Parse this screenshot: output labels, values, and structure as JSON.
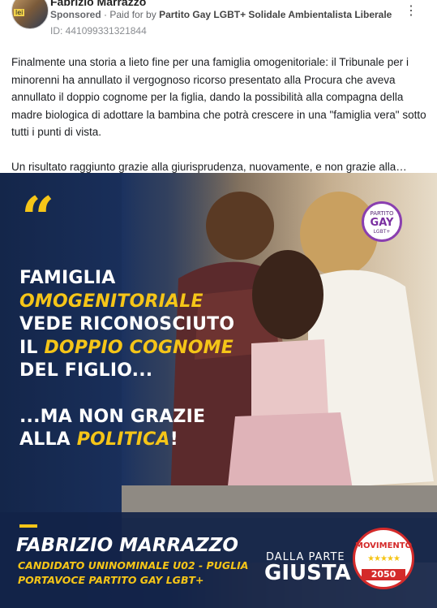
{
  "post": {
    "author": "Fabrizio Marrazzo",
    "avatar_tag": "lei",
    "sponsored": "Sponsored",
    "paid_for_prefix": "· Paid for by",
    "advertiser": "Partito Gay LGBT+ Solidale Ambientalista Liberale",
    "library_id": "ID: 441099331321844",
    "more_icon": "⋮",
    "paragraphs": [
      "Finalmente una storia a lieto fine per una famiglia omogenitoriale: il Tribunale per i minorenni ha annullato il vergognoso ricorso presentato alla Procura che aveva annullato il doppio cognome per la figlia, dando la possibilità alla compagna della madre biologica di adottare la bambina che potrà crescere in una \"famiglia vera\" sotto tutti i punti di vista.",
      "Un risultato raggiunto grazie alla giurisprudenza, nuovamente, e non grazie alla…"
    ]
  },
  "creative": {
    "quote_mark": "“",
    "headline": {
      "l1": "FAMIGLIA",
      "l2": "OMOGENITORIALE",
      "l3": "VEDE RICONOSCIUTO",
      "l4a": "IL ",
      "l4b": "DOPPIO COGNOME",
      "l5": "DEL FIGLIO...",
      "l6": "...MA NON GRAZIE",
      "l7a": "ALLA ",
      "l7b": "POLITICA",
      "l7c": "!"
    },
    "candidate": {
      "name": "FABRIZIO MARRAZZO",
      "line1": "CANDIDATO UNINOMINALE U02 - PUGLIA",
      "line2": "PORTAVOCE PARTITO GAY LGBT+"
    },
    "slogan_small": "DALLA PARTE",
    "slogan_big": "GIUSTA",
    "m5s_logo": {
      "text": "MOVIMENTO",
      "stars": "★★★★★",
      "year": "2050"
    },
    "party_logo": {
      "top": "PARTITO",
      "mid": "GAY",
      "bottom": "LGBT+"
    }
  },
  "colors": {
    "accent_yellow": "#f5c518",
    "navy": "#14264a",
    "m5s_red": "#d42a2a"
  }
}
